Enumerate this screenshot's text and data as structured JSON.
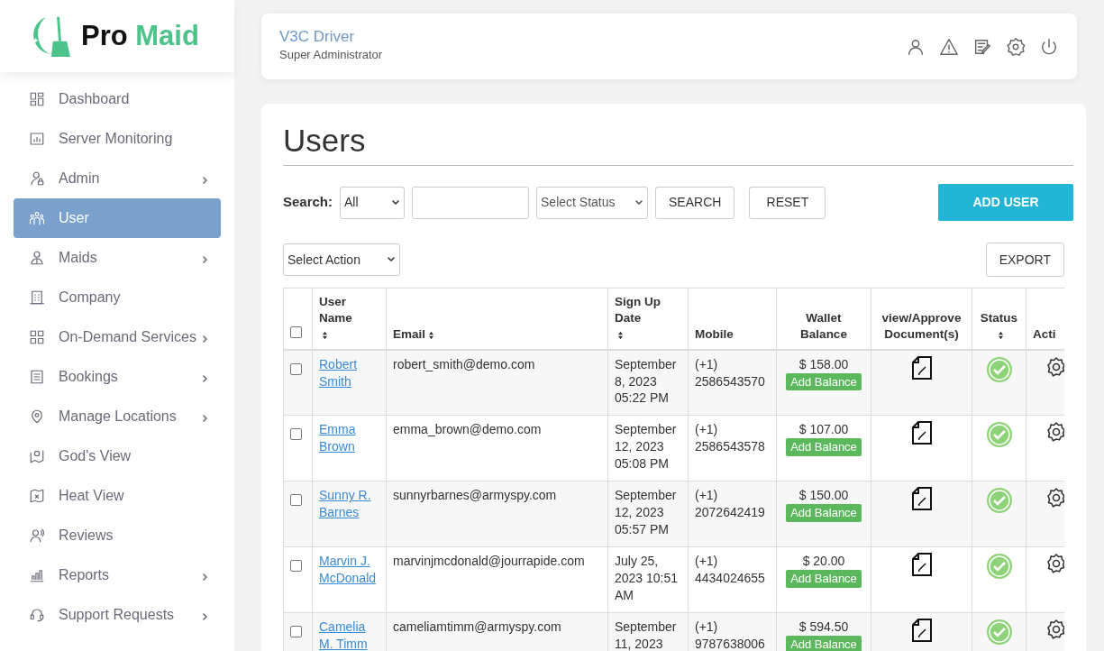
{
  "brand": {
    "first": "Pro",
    "second": "Maid"
  },
  "sidebar": {
    "items": [
      {
        "label": "Dashboard",
        "submenu": false,
        "selected": false
      },
      {
        "label": "Server Monitoring",
        "submenu": false,
        "selected": false
      },
      {
        "label": "Admin",
        "submenu": true,
        "selected": false
      },
      {
        "label": "User",
        "submenu": false,
        "selected": true
      },
      {
        "label": "Maids",
        "submenu": true,
        "selected": false
      },
      {
        "label": "Company",
        "submenu": false,
        "selected": false
      },
      {
        "label": "On-Demand Services",
        "submenu": true,
        "selected": false
      },
      {
        "label": "Bookings",
        "submenu": true,
        "selected": false
      },
      {
        "label": "Manage Locations",
        "submenu": true,
        "selected": false
      },
      {
        "label": "God's View",
        "submenu": false,
        "selected": false
      },
      {
        "label": "Heat View",
        "submenu": false,
        "selected": false
      },
      {
        "label": "Reviews",
        "submenu": false,
        "selected": false
      },
      {
        "label": "Reports",
        "submenu": true,
        "selected": false
      },
      {
        "label": "Support Requests",
        "submenu": true,
        "selected": false
      }
    ]
  },
  "header": {
    "user_name": "V3C Driver",
    "role": "Super Administrator"
  },
  "page": {
    "title": "Users",
    "search": {
      "label": "Search:",
      "type_value": "All",
      "status_placeholder": "Select Status",
      "search_button": "SEARCH",
      "reset_button": "RESET",
      "add_button": "ADD USER"
    },
    "action_select": "Select Action",
    "export_button": "EXPORT"
  },
  "table": {
    "select_all_checked": false,
    "columns": [
      {
        "label": "User Name",
        "sortable": true
      },
      {
        "label": "Email",
        "sortable": true
      },
      {
        "label": "Sign Up Date",
        "sortable": true
      },
      {
        "label": "Mobile",
        "sortable": false
      },
      {
        "label": "Wallet Balance",
        "sortable": false
      },
      {
        "label": "view/Approve Document(s)",
        "sortable": false
      },
      {
        "label": "Status",
        "sortable": true
      },
      {
        "label": "Acti",
        "sortable": false
      }
    ],
    "rows": [
      {
        "checked": false,
        "name": "Robert Smith",
        "email": "robert_smith@demo.com",
        "signup": "September 8, 2023 05:22 PM",
        "mobile_code": "(+1)",
        "mobile": "2586543570",
        "balance": "$ 158.00",
        "add_balance": "Add Balance",
        "active": true
      },
      {
        "checked": false,
        "name": "Emma Brown",
        "email": "emma_brown@demo.com",
        "signup": "September 12, 2023 05:08 PM",
        "mobile_code": "(+1)",
        "mobile": "2586543578",
        "balance": "$ 107.00",
        "add_balance": "Add Balance",
        "active": true
      },
      {
        "checked": false,
        "name": "Sunny R. Barnes",
        "email": "sunnyrbarnes@armyspy.com",
        "signup": "September 12, 2023 05:57 PM",
        "mobile_code": "(+1)",
        "mobile": "2072642419",
        "balance": "$ 150.00",
        "add_balance": "Add Balance",
        "active": true
      },
      {
        "checked": false,
        "name": "Marvin J. McDonald",
        "email": "marvinjmcdonald@jourrapide.com",
        "signup": "July 25, 2023 10:51 AM",
        "mobile_code": "(+1)",
        "mobile": "4434024655",
        "balance": "$ 20.00",
        "add_balance": "Add Balance",
        "active": true
      },
      {
        "checked": false,
        "name": "Camelia M. Timm",
        "email": "cameliamtimm@armyspy.com",
        "signup": "September 11, 2023",
        "mobile_code": "(+1)",
        "mobile": "9787638006",
        "balance": "$ 594.50",
        "add_balance": "Add Balance",
        "active": true
      }
    ]
  }
}
